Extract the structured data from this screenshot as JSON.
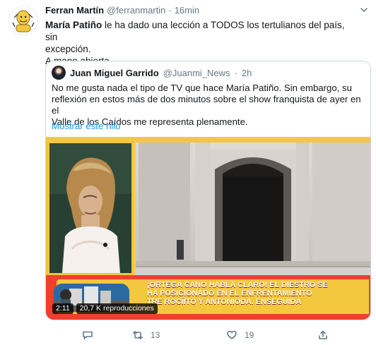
{
  "tweet": {
    "author": {
      "name": "Ferran Martín",
      "handle": "@ferranmartin",
      "separator": "·",
      "time": "16min"
    },
    "text": {
      "bold": "María Patiño",
      "line1_rest": " le ha dado una lección a TODOS los tertulianos del país, sin",
      "line2": "excepción.",
      "line3": "A mano abierta."
    }
  },
  "quoted_tweet": {
    "author": {
      "name": "Juan Miguel Garrido",
      "handle": "@Juanmi_News",
      "separator": "·",
      "time": "2h"
    },
    "text": [
      "No me gusta nada el tipo de TV que hace María Patiño. Sin embargo, su",
      "reflexión en estos más de dos minutos sobre el show franquista de ayer en el",
      "Valle de los Caídos me representa plenamente."
    ],
    "show_thread": "Mostrar este hilo",
    "video": {
      "duration": "2:11",
      "views": "20,7 K reproducciones",
      "banner_text": [
        "¡ORTEGA CANO HABLA CLARO! EL DIESTRO SE",
        "HA POSICIONADO EN EL ENFRENTAMIENTO",
        "TRE ROCÍITO Y ANTONIODA. ENSEGUIDA"
      ]
    }
  },
  "actions": {
    "retweets": "13",
    "likes": "19"
  },
  "icons": {
    "chevron": "chevron-down-icon",
    "reply": "reply-icon",
    "retweet": "retweet-icon",
    "like": "heart-icon",
    "share": "share-icon"
  },
  "colors": {
    "link": "#1b95e0",
    "muted": "#657786",
    "banner_red": "#ef3f2f",
    "banner_yellow": "#f3c83f"
  }
}
